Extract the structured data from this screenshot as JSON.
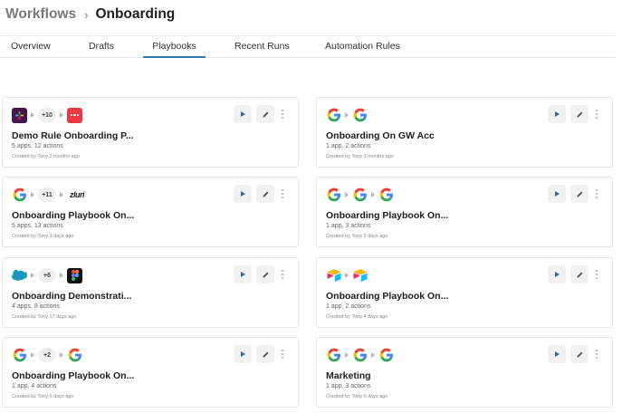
{
  "breadcrumb": {
    "parent": "Workflows",
    "separator": "›",
    "current": "Onboarding"
  },
  "tabs": [
    {
      "label": "Overview",
      "active": false
    },
    {
      "label": "Drafts",
      "active": false
    },
    {
      "label": "Playbooks",
      "active": true
    },
    {
      "label": "Recent Runs",
      "active": false
    },
    {
      "label": "Automation Rules",
      "active": false
    }
  ],
  "accent_color": "#2b7bb9",
  "cards": [
    {
      "title": "Demo Rule Onboarding P...",
      "subtitle": "5 apps, 12 actions",
      "meta": "Created by Tony 2 months ago",
      "icons": [
        "slack-icon",
        "more-apps-badge",
        "red-dots-app-icon"
      ],
      "more_count": "+10"
    },
    {
      "title": "Onboarding On GW Acc",
      "subtitle": "1 app, 2 actions",
      "meta": "Created by Tony 3 months ago",
      "icons": [
        "google-icon",
        "google-icon"
      ]
    },
    {
      "title": "Onboarding Playbook On...",
      "subtitle": "5 apps, 13 actions",
      "meta": "Created by Tony 3 days ago",
      "icons": [
        "google-icon",
        "more-apps-badge",
        "zluri-icon"
      ],
      "more_count": "+11",
      "zluri_text": "zluri"
    },
    {
      "title": "Onboarding Playbook On...",
      "subtitle": "1 app, 3 actions",
      "meta": "Created by Tony 3 days ago",
      "icons": [
        "google-icon",
        "google-icon",
        "google-icon"
      ]
    },
    {
      "title": "Onboarding Demonstrati...",
      "subtitle": "4 apps, 8 actions",
      "meta": "Created by Tony 17 days ago",
      "icons": [
        "salesforce-icon",
        "more-apps-badge",
        "figma-icon"
      ],
      "more_count": "+6"
    },
    {
      "title": "Onboarding Playbook On...",
      "subtitle": "1 app, 2 actions",
      "meta": "Created by Tony 4 days ago",
      "icons": [
        "airtable-icon",
        "airtable-icon"
      ]
    },
    {
      "title": "Onboarding Playbook On...",
      "subtitle": "1 app, 4 actions",
      "meta": "Created by Tony 6 days ago",
      "icons": [
        "google-icon",
        "more-apps-badge",
        "google-icon"
      ],
      "more_count": "+2"
    },
    {
      "title": "Marketing",
      "subtitle": "1 app, 3 actions",
      "meta": "Created by Tony 6 days ago",
      "icons": [
        "google-icon",
        "google-icon",
        "google-icon"
      ]
    }
  ]
}
